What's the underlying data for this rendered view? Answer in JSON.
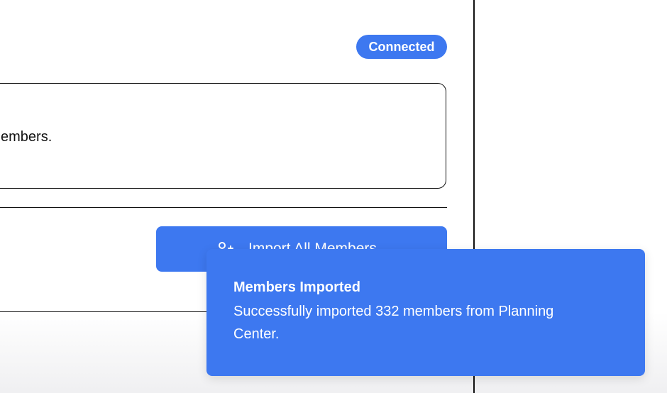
{
  "header": {
    "status_badge": "Connected"
  },
  "info_card": {
    "text": "embers."
  },
  "actions": {
    "import_button_label": "Import All Members",
    "import_button_icon": "user-plus-icon"
  },
  "toast": {
    "title": "Members Imported",
    "message": "Successfully imported 332 members from Planning Center."
  },
  "colors": {
    "accent": "#3d78f0",
    "text": "#111111",
    "on_accent": "#ffffff"
  }
}
